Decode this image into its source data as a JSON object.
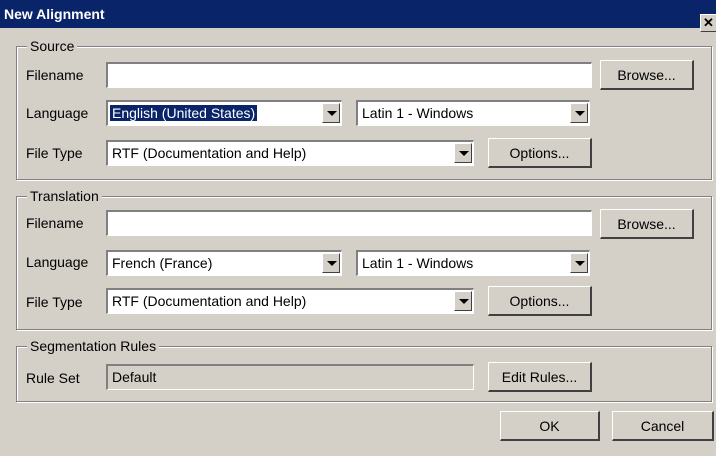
{
  "window": {
    "title": "New Alignment",
    "close_glyph": "✕"
  },
  "source": {
    "legend": "Source",
    "filename_label": "Filename",
    "filename_value": "",
    "browse_label": "Browse...",
    "language_label": "Language",
    "language_value": "English (United States)",
    "encoding_value": "Latin 1 - Windows",
    "filetype_label": "File Type",
    "filetype_value": "RTF (Documentation and Help)",
    "options_label": "Options..."
  },
  "translation": {
    "legend": "Translation",
    "filename_label": "Filename",
    "filename_value": "",
    "browse_label": "Browse...",
    "language_label": "Language",
    "language_value": "French (France)",
    "encoding_value": "Latin 1 - Windows",
    "filetype_label": "File Type",
    "filetype_value": "RTF (Documentation and Help)",
    "options_label": "Options..."
  },
  "segmentation": {
    "legend": "Segmentation Rules",
    "ruleset_label": "Rule Set",
    "ruleset_value": "Default",
    "edit_rules_label": "Edit Rules..."
  },
  "footer": {
    "ok_label": "OK",
    "cancel_label": "Cancel"
  },
  "colors": {
    "titlebar": "#0a246a",
    "face": "#d4d0c8",
    "selection": "#0a246a"
  }
}
